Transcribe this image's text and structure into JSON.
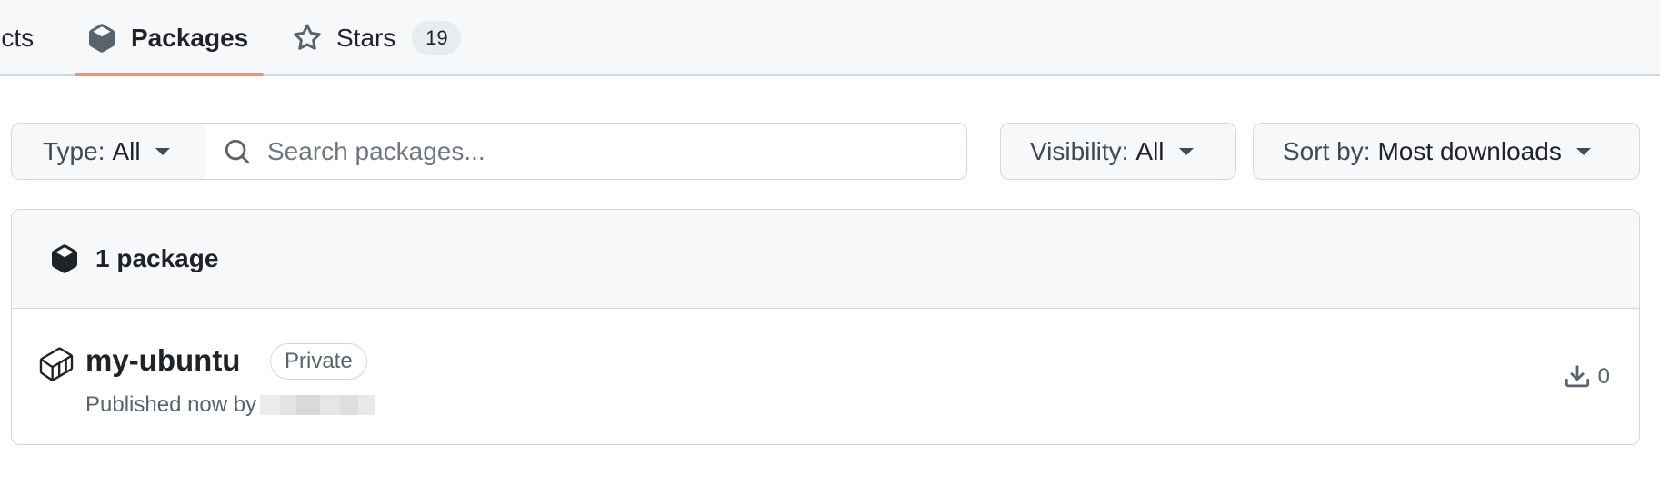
{
  "tabs": {
    "projects_label": "Projects",
    "packages_label": "Packages",
    "stars_label": "Stars",
    "stars_count": "19"
  },
  "filters": {
    "type_label": "Type:",
    "type_value": "All",
    "search_placeholder": "Search packages...",
    "visibility_label": "Visibility:",
    "visibility_value": "All",
    "sort_label": "Sort by:",
    "sort_value": "Most downloads"
  },
  "packages": {
    "count_label": "1 package",
    "items": [
      {
        "name": "my-ubuntu",
        "visibility": "Private",
        "published": "Published now by",
        "downloads": "0"
      }
    ]
  },
  "icons": {
    "package": "package-icon",
    "star": "star-icon",
    "search": "search-icon",
    "container": "container-icon",
    "download": "download-icon"
  },
  "colors": {
    "accent_underline": "#fd8c73",
    "border": "#d0d7de",
    "muted_text": "#59636e"
  }
}
